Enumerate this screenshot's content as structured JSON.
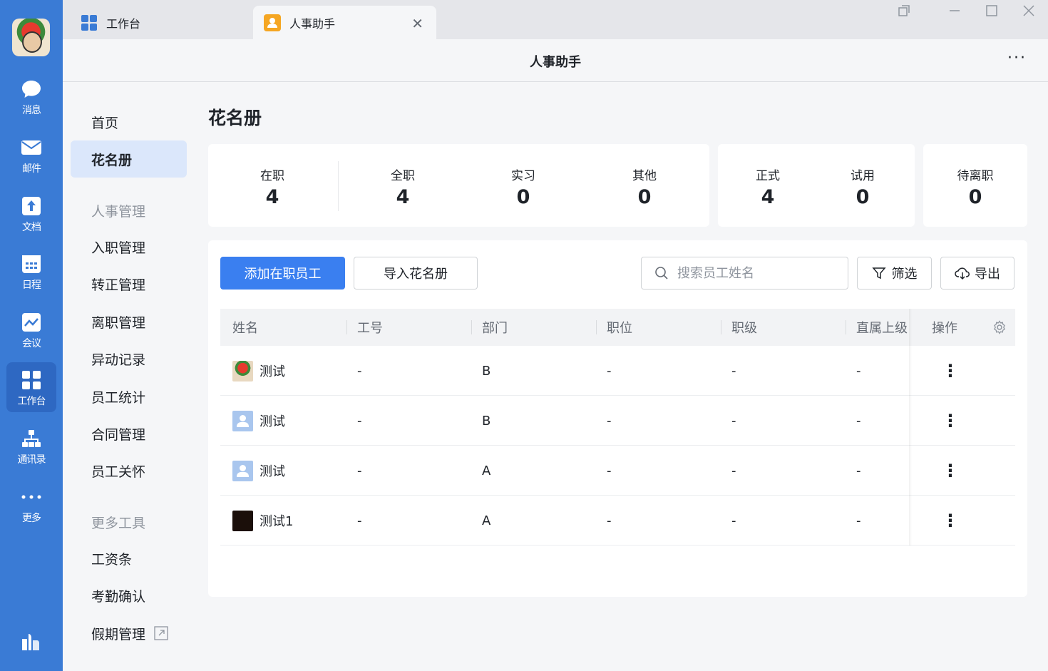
{
  "rail": {
    "items": [
      {
        "label": "消息",
        "icon": "chat-bubble-icon"
      },
      {
        "label": "邮件",
        "icon": "mail-icon"
      },
      {
        "label": "文档",
        "icon": "doc-icon"
      },
      {
        "label": "日程",
        "icon": "calendar-icon"
      },
      {
        "label": "会议",
        "icon": "meeting-icon"
      },
      {
        "label": "工作台",
        "icon": "grid-icon"
      },
      {
        "label": "通讯录",
        "icon": "org-icon"
      },
      {
        "label": "更多",
        "icon": "more-icon"
      }
    ]
  },
  "tabs": [
    {
      "label": "工作台",
      "icon": "grid-icon",
      "color": "#3a7bd5"
    },
    {
      "label": "人事助手",
      "icon": "person-icon",
      "color": "#f5a623"
    }
  ],
  "header": {
    "title": "人事助手",
    "more": "···"
  },
  "nav": {
    "home": "首页",
    "roster": "花名册",
    "group_hr": "人事管理",
    "onboarding": "入职管理",
    "regularization": "转正管理",
    "offboarding": "离职管理",
    "changes": "异动记录",
    "stats": "员工统计",
    "contracts": "合同管理",
    "care": "员工关怀",
    "group_tools": "更多工具",
    "payslip": "工资条",
    "attendance": "考勤确认",
    "leave": "假期管理"
  },
  "page": {
    "title": "花名册"
  },
  "stats": {
    "active": {
      "label": "在职",
      "value": "4"
    },
    "fulltime": {
      "label": "全职",
      "value": "4"
    },
    "intern": {
      "label": "实习",
      "value": "0"
    },
    "other": {
      "label": "其他",
      "value": "0"
    },
    "formal": {
      "label": "正式",
      "value": "4"
    },
    "probation": {
      "label": "试用",
      "value": "0"
    },
    "pending_leave": {
      "label": "待离职",
      "value": "0"
    }
  },
  "toolbar": {
    "add": "添加在职员工",
    "import": "导入花名册",
    "search_placeholder": "搜索员工姓名",
    "filter": "筛选",
    "export": "导出"
  },
  "table": {
    "headers": {
      "name": "姓名",
      "id": "工号",
      "dept": "部门",
      "position": "职位",
      "level": "职级",
      "manager": "直属上级",
      "ops": "操作"
    },
    "rows": [
      {
        "name": "测试",
        "id": "-",
        "dept": "B",
        "position": "-",
        "level": "-",
        "manager": "-",
        "avatar": "photo"
      },
      {
        "name": "测试",
        "id": "-",
        "dept": "B",
        "position": "-",
        "level": "-",
        "manager": "-",
        "avatar": "default"
      },
      {
        "name": "测试",
        "id": "-",
        "dept": "A",
        "position": "-",
        "level": "-",
        "manager": "-",
        "avatar": "default"
      },
      {
        "name": "测试1",
        "id": "-",
        "dept": "A",
        "position": "-",
        "level": "-",
        "manager": "-",
        "avatar": "dark"
      }
    ]
  }
}
